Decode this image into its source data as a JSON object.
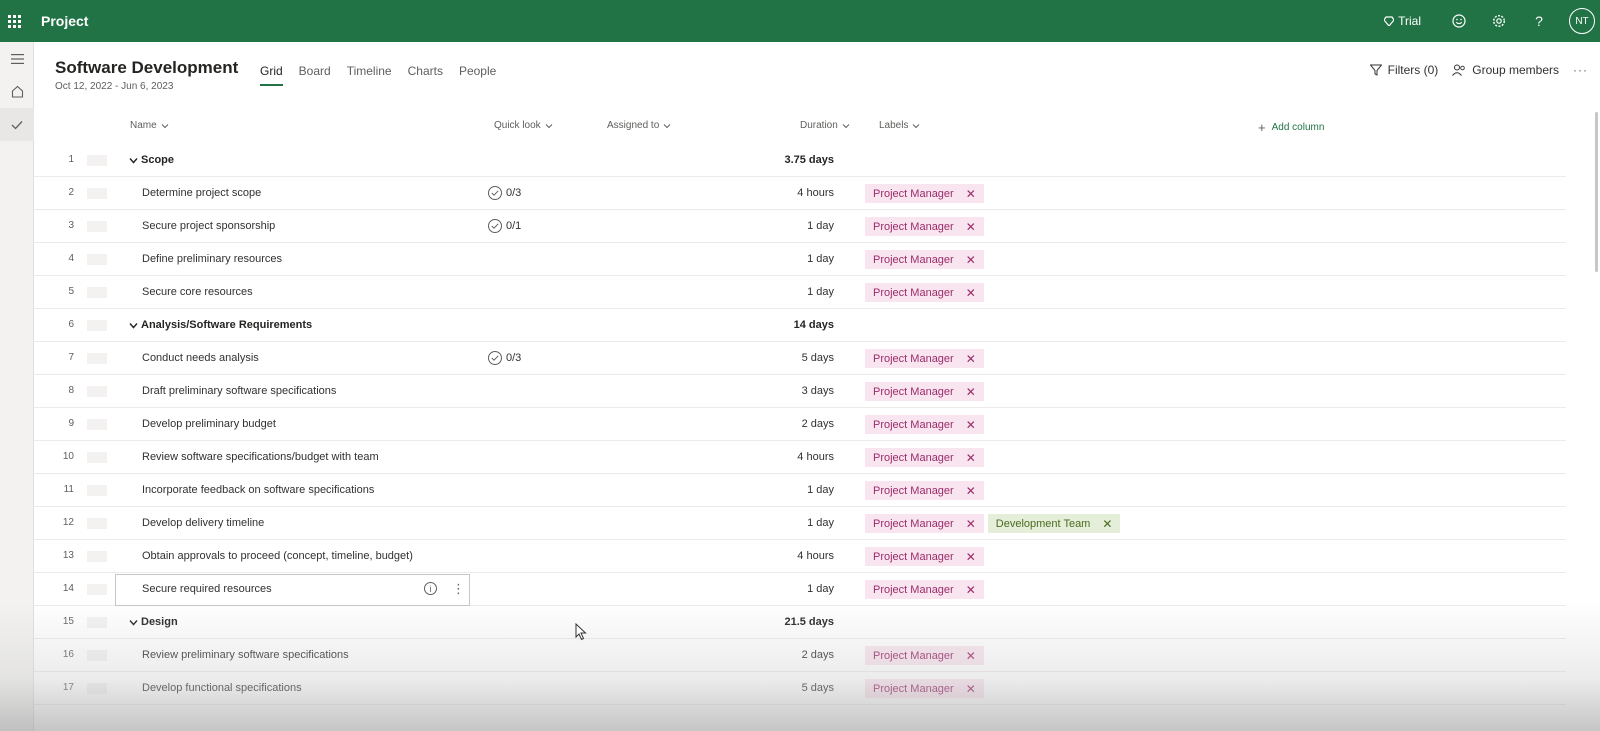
{
  "app": {
    "title": "Project"
  },
  "topbar": {
    "trial_label": "Trial",
    "avatar_initials": "NT",
    "brand_color": "#217346"
  },
  "project": {
    "title": "Software Development",
    "dates": "Oct 12, 2022 - Jun 6, 2023"
  },
  "tabs": [
    {
      "label": "Grid",
      "active": true
    },
    {
      "label": "Board",
      "active": false
    },
    {
      "label": "Timeline",
      "active": false
    },
    {
      "label": "Charts",
      "active": false
    },
    {
      "label": "People",
      "active": false
    }
  ],
  "header_actions": {
    "filters": "Filters (0)",
    "group_members": "Group members"
  },
  "columns": {
    "name": "Name",
    "quick_look": "Quick look",
    "assigned_to": "Assigned to",
    "duration": "Duration",
    "labels": "Labels",
    "add_column": "Add column"
  },
  "rows": [
    {
      "num": "1",
      "name": "Scope",
      "summary": true,
      "duration": "3.75 days",
      "quick_look": "",
      "labels": []
    },
    {
      "num": "2",
      "name": "Determine project scope",
      "summary": false,
      "duration": "4 hours",
      "quick_look": "0/3",
      "labels": [
        "Project Manager"
      ]
    },
    {
      "num": "3",
      "name": "Secure project sponsorship",
      "summary": false,
      "duration": "1 day",
      "quick_look": "0/1",
      "labels": [
        "Project Manager"
      ]
    },
    {
      "num": "4",
      "name": "Define preliminary resources",
      "summary": false,
      "duration": "1 day",
      "quick_look": "",
      "labels": [
        "Project Manager"
      ]
    },
    {
      "num": "5",
      "name": "Secure core resources",
      "summary": false,
      "duration": "1 day",
      "quick_look": "",
      "labels": [
        "Project Manager"
      ]
    },
    {
      "num": "6",
      "name": "Analysis/Software Requirements",
      "summary": true,
      "duration": "14 days",
      "quick_look": "",
      "labels": []
    },
    {
      "num": "7",
      "name": "Conduct needs analysis",
      "summary": false,
      "duration": "5 days",
      "quick_look": "0/3",
      "labels": [
        "Project Manager"
      ]
    },
    {
      "num": "8",
      "name": "Draft preliminary software specifications",
      "summary": false,
      "duration": "3 days",
      "quick_look": "",
      "labels": [
        "Project Manager"
      ]
    },
    {
      "num": "9",
      "name": "Develop preliminary budget",
      "summary": false,
      "duration": "2 days",
      "quick_look": "",
      "labels": [
        "Project Manager"
      ]
    },
    {
      "num": "10",
      "name": "Review software specifications/budget with team",
      "summary": false,
      "duration": "4 hours",
      "quick_look": "",
      "labels": [
        "Project Manager"
      ]
    },
    {
      "num": "11",
      "name": "Incorporate feedback on software specifications",
      "summary": false,
      "duration": "1 day",
      "quick_look": "",
      "labels": [
        "Project Manager"
      ]
    },
    {
      "num": "12",
      "name": "Develop delivery timeline",
      "summary": false,
      "duration": "1 day",
      "quick_look": "",
      "labels": [
        "Project Manager",
        "Development Team"
      ]
    },
    {
      "num": "13",
      "name": "Obtain approvals to proceed (concept, timeline, budget)",
      "summary": false,
      "duration": "4 hours",
      "quick_look": "",
      "labels": [
        "Project Manager"
      ]
    },
    {
      "num": "14",
      "name": "Secure required resources",
      "summary": false,
      "duration": "1 day",
      "quick_look": "",
      "labels": [
        "Project Manager"
      ],
      "editing": true
    },
    {
      "num": "15",
      "name": "Design",
      "summary": true,
      "duration": "21.5 days",
      "quick_look": "",
      "labels": []
    },
    {
      "num": "16",
      "name": "Review preliminary software specifications",
      "summary": false,
      "duration": "2 days",
      "quick_look": "",
      "labels": [
        "Project Manager"
      ]
    },
    {
      "num": "17",
      "name": "Develop functional specifications",
      "summary": false,
      "duration": "5 days",
      "quick_look": "",
      "labels": [
        "Project Manager"
      ]
    }
  ]
}
